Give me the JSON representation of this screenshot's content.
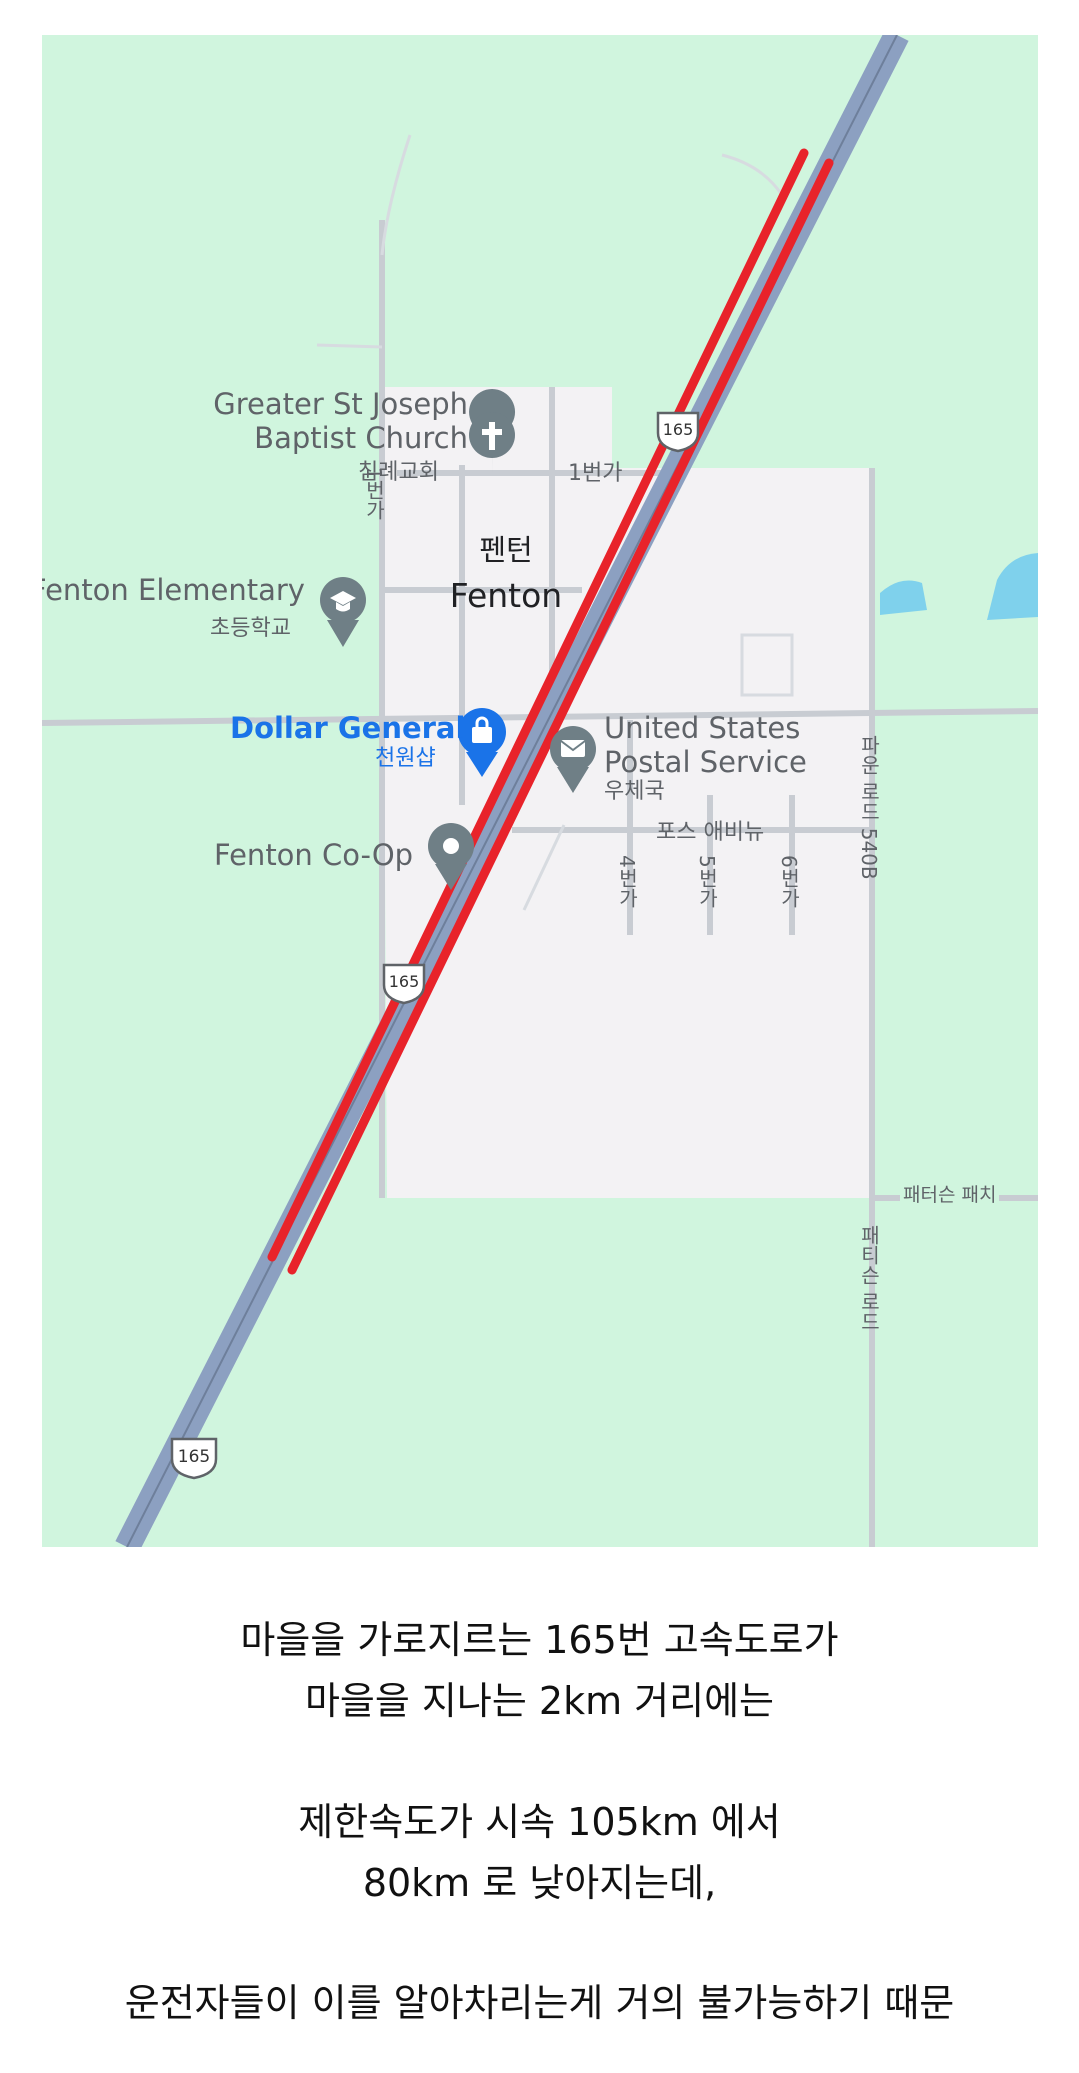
{
  "map": {
    "town": {
      "ko": "펜턴",
      "en": "Fenton"
    },
    "places": [
      {
        "name": "Greater St Joseph Baptist Church",
        "ko": "침례교회",
        "icon": "cross-icon"
      },
      {
        "name": "Fenton Elementary",
        "ko": "초등학교",
        "icon": "graduation-cap-icon"
      },
      {
        "name": "Dollar General",
        "ko": "천원샵",
        "icon": "shopping-bag-icon"
      },
      {
        "name": "United States Postal Service",
        "ko": "우체국",
        "icon": "envelope-icon"
      },
      {
        "name": "Fenton Co-Op",
        "icon": "place-pin-icon"
      }
    ],
    "streets": [
      "1번가",
      "1번가",
      "포스 애비뉴",
      "4번가",
      "5번가",
      "6번가",
      "파운 로드 540B",
      "패터슨 패치",
      "패티슨 로드"
    ],
    "highway_shields": [
      "165",
      "165",
      "165"
    ],
    "colors": {
      "land": "#d0f5de",
      "town": "#f3f2f4",
      "highway": "#8ca0c1",
      "route_highlight": "#e8232a",
      "water": "#7fd1ec"
    }
  },
  "caption": [
    "마을을 가로지르는 165번 고속도로가",
    "마을을 지나는 2km 거리에는",
    "제한속도가 시속 105km 에서",
    "80km 로 낮아지는데,",
    "운전자들이 이를 알아차리는게 거의 불가능하기 때문"
  ]
}
